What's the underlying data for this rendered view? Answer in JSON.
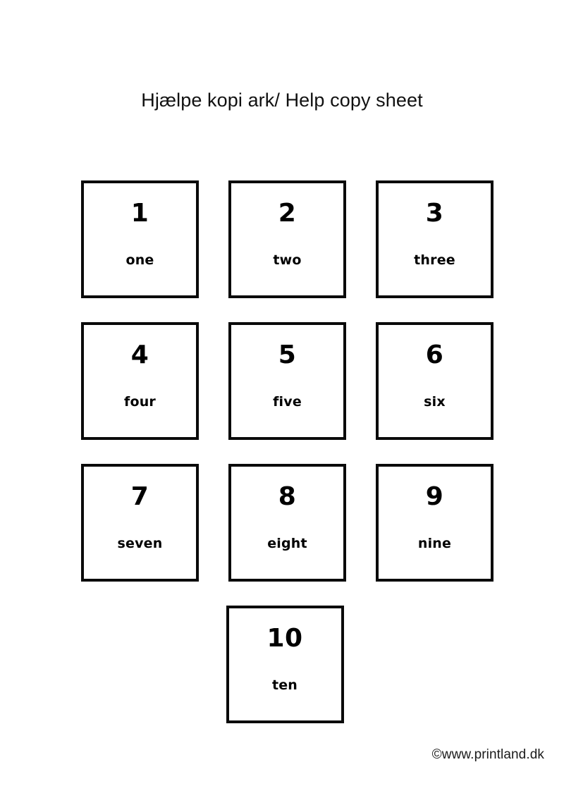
{
  "page": {
    "title": "Hjælpe kopi ark/ Help copy sheet",
    "background_color": "#ffffff",
    "ink_color": "#000000"
  },
  "cards": [
    {
      "number": "1",
      "word": "one"
    },
    {
      "number": "2",
      "word": "two"
    },
    {
      "number": "3",
      "word": "three"
    },
    {
      "number": "4",
      "word": "four"
    },
    {
      "number": "5",
      "word": "five"
    },
    {
      "number": "6",
      "word": "six"
    },
    {
      "number": "7",
      "word": "seven"
    },
    {
      "number": "8",
      "word": "eight"
    },
    {
      "number": "9",
      "word": "nine"
    },
    {
      "number": "10",
      "word": "ten"
    }
  ],
  "footer": {
    "credit": "©www.printland.dk"
  }
}
